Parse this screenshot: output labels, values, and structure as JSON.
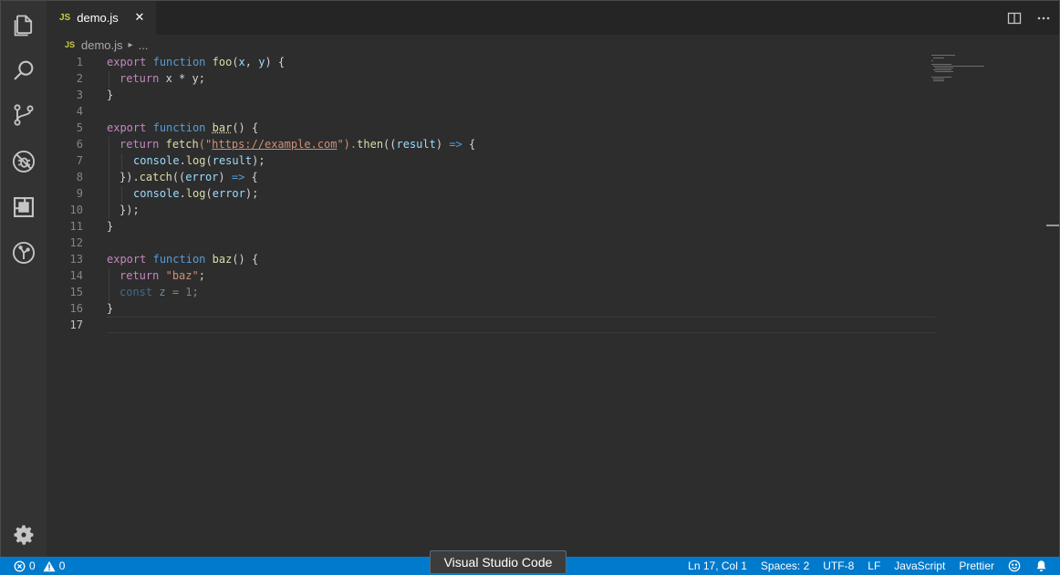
{
  "tab": {
    "badge": "JS",
    "label": "demo.js",
    "close": "✕"
  },
  "breadcrumb": {
    "badge": "JS",
    "file": "demo.js",
    "separator": "▸",
    "more": "..."
  },
  "editor": {
    "lines": [
      "1",
      "2",
      "3",
      "4",
      "5",
      "6",
      "7",
      "8",
      "9",
      "10",
      "11",
      "12",
      "13",
      "14",
      "15",
      "16",
      "17"
    ],
    "active_line": "17"
  },
  "code": {
    "l1": [
      "export",
      " ",
      "function",
      " ",
      "foo",
      "(",
      "x",
      ", ",
      "y",
      ") {"
    ],
    "l2": [
      "return",
      " x * y;"
    ],
    "l3": "}",
    "l5": [
      "export",
      " ",
      "function",
      " ",
      "bar",
      "() {"
    ],
    "l6": [
      "return",
      " ",
      "fetch",
      "(\"",
      "https://example.com",
      "\").",
      "then",
      "((",
      "result",
      ") ",
      "=>",
      " {"
    ],
    "l7": [
      "console",
      ".",
      "log",
      "(",
      "result",
      ");"
    ],
    "l8": [
      "}).",
      "catch",
      "((",
      "error",
      ") ",
      "=>",
      " {"
    ],
    "l9": [
      "console",
      ".",
      "log",
      "(",
      "error",
      ");"
    ],
    "l10": "});",
    "l11": "}",
    "l13": [
      "export",
      " ",
      "function",
      " ",
      "baz",
      "() {"
    ],
    "l14": [
      "return",
      " ",
      "\"baz\"",
      ";"
    ],
    "l15": [
      "const",
      " ",
      "z",
      " = ",
      "1",
      ";"
    ],
    "l16": "}"
  },
  "status": {
    "errors": "0",
    "warnings": "0",
    "position": "Ln 17, Col 1",
    "spaces": "Spaces: 2",
    "encoding": "UTF-8",
    "eol": "LF",
    "language": "JavaScript",
    "formatter": "Prettier"
  },
  "tooltip": "Visual Studio Code",
  "icons": {
    "activity": [
      "explorer-icon",
      "search-icon",
      "source-control-icon",
      "debug-icon",
      "extensions-icon",
      "git-lens-icon"
    ],
    "settings": "gear-icon"
  },
  "colors": {
    "status_bar": "#007acc",
    "activity_bar": "#333333",
    "editor_bg": "#2d2d2d"
  }
}
